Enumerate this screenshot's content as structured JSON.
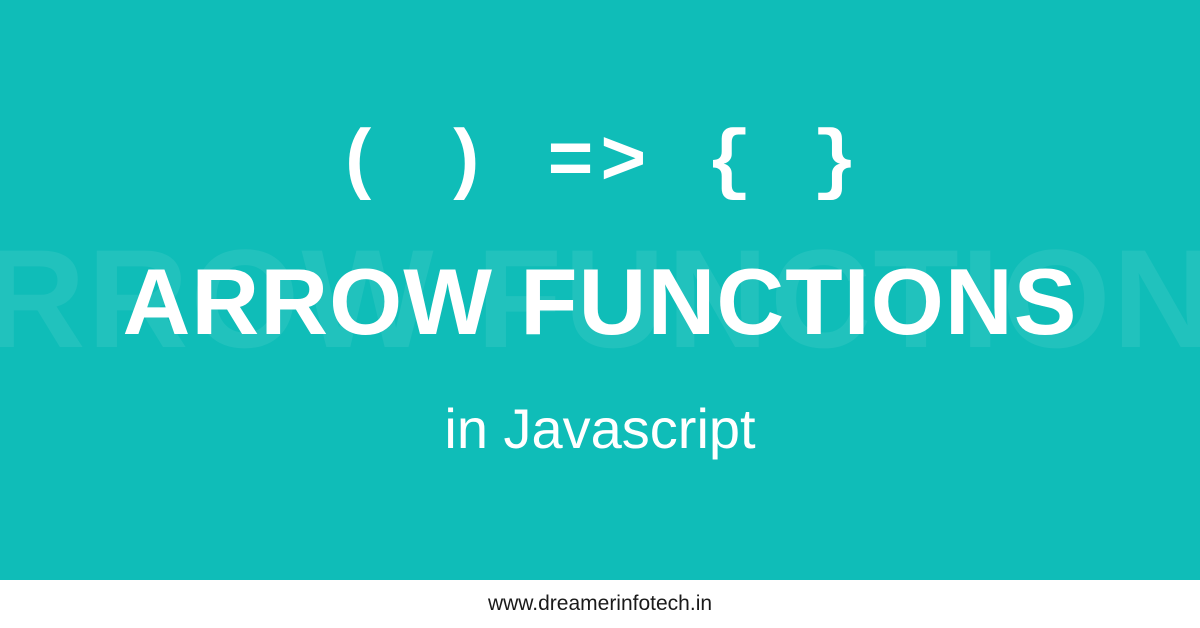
{
  "banner": {
    "code_syntax": "( ) => { }",
    "title_shadow": "RROW FUNCTION",
    "title_main": "ARROW FUNCTIONS",
    "subtitle": "in Javascript"
  },
  "footer": {
    "url": "www.dreamerinfotech.in"
  },
  "colors": {
    "background": "#0fbdb8",
    "text": "#ffffff",
    "footer_background": "#ffffff",
    "footer_text": "#1a1a1a"
  }
}
